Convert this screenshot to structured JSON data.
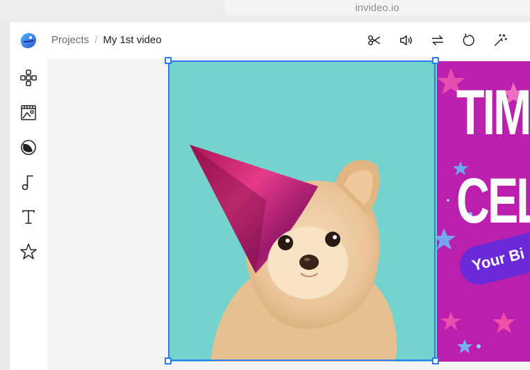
{
  "browser": {
    "url": "invideo.io"
  },
  "header": {
    "breadcrumb": {
      "projects": "Projects",
      "separator": "/",
      "current": "My 1st video"
    },
    "tools": [
      {
        "name": "scissors-icon"
      },
      {
        "name": "volume-icon"
      },
      {
        "name": "swap-icon"
      },
      {
        "name": "rotate-icon"
      },
      {
        "name": "magic-wand-icon"
      }
    ]
  },
  "sidebar": {
    "items": [
      {
        "name": "templates-icon"
      },
      {
        "name": "media-icon"
      },
      {
        "name": "stickers-icon"
      },
      {
        "name": "music-icon"
      },
      {
        "name": "text-icon"
      },
      {
        "name": "favorites-icon"
      }
    ]
  },
  "canvas": {
    "scene2": {
      "line1": "TIM",
      "line2": "CEL",
      "pill": "Your Bi"
    }
  },
  "colors": {
    "accent": "#2a7bf6",
    "scene1_bg": "#74d3cd",
    "scene2_bg": "#bb1fae",
    "pill": "#6a2ad8"
  }
}
